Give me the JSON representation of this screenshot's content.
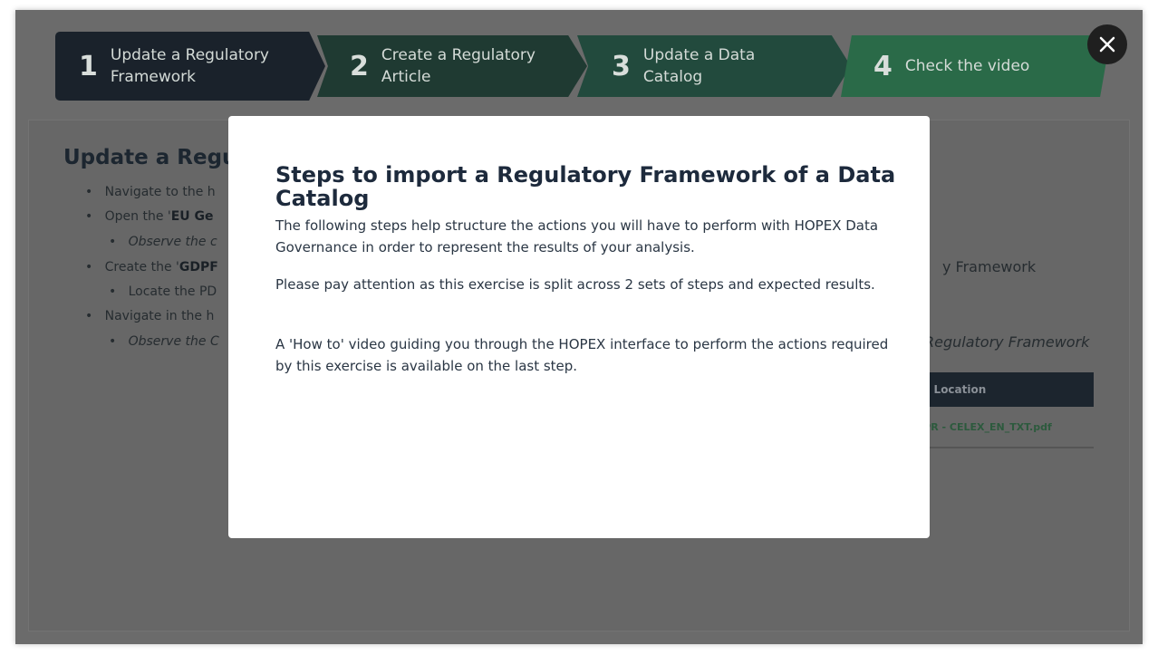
{
  "steps": [
    {
      "number": "1",
      "label": "Update a Regulatory Framework"
    },
    {
      "number": "2",
      "label": "Create a Regulatory Article"
    },
    {
      "number": "3",
      "label": "Update a Data Catalog"
    },
    {
      "number": "4",
      "label": "Check the video"
    }
  ],
  "close_icon": "close-icon",
  "background": {
    "title": "Update a Regu",
    "bullets": [
      {
        "pre": "Navigate to the h",
        "bold": "",
        "post": ""
      },
      {
        "pre": "Open the '",
        "bold": "EU Ge",
        "post": ""
      },
      {
        "pre": "",
        "bold": "",
        "post": "Observe the c"
      },
      {
        "pre": "Create the '",
        "bold": "GDPF",
        "post": ""
      },
      {
        "pre": "Locate the PD",
        "bold": "",
        "post": ""
      },
      {
        "pre": "Navigate in the h",
        "bold": "",
        "post": ""
      },
      {
        "pre": "",
        "bold": "",
        "post": "Observe the C"
      }
    ],
    "right_text_1": "y Framework",
    "right_text_2": "Regulatory Framework",
    "table": {
      "header": "ile Location",
      "cell": "DPR - CELEX_EN_TXT.pdf"
    }
  },
  "modal": {
    "title": "Steps to import a Regulatory Framework of a Data Catalog",
    "paragraphs": [
      "The following steps help structure the actions you will have to perform with HOPEX Data Governance in order to represent the results of your analysis.",
      "Please pay attention as this exercise is split across 2 sets of steps and expected results.",
      "A 'How to' video guiding you through the HOPEX interface to perform the actions required by this exercise is available on the last step."
    ]
  }
}
